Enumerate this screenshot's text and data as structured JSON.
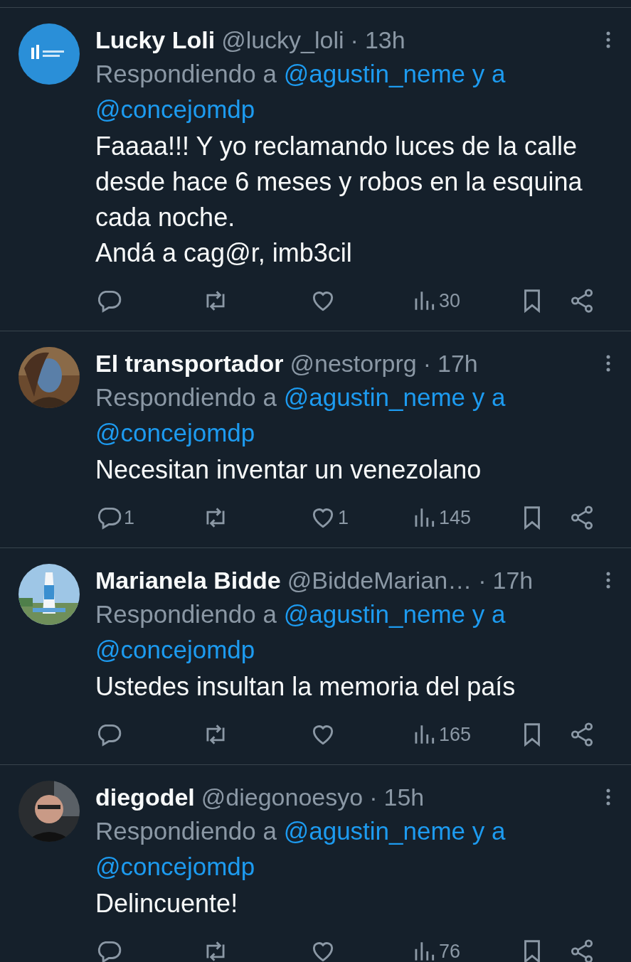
{
  "replies": [
    {
      "name": "Lucky Loli",
      "handle": "@lucky_loli",
      "separator": "·",
      "time": "13h",
      "reply_label": "Respondiendo a",
      "reply_links": [
        "@agustin_neme y a",
        "@concejomdp"
      ],
      "body": [
        "Faaaa!!! Y yo reclamando luces de la calle desde hace 6 meses y robos en la esquina cada noche.",
        "Andá a cag@r, imb3cil"
      ],
      "views": "30"
    },
    {
      "name": "El transportador",
      "handle": "@nestorprg",
      "separator": "·",
      "time": "17h",
      "reply_label": "Respondiendo a",
      "reply_links": [
        "@agustin_neme y a",
        "@concejomdp"
      ],
      "body": [
        "Necesitan inventar un venezolano"
      ],
      "replies_count": "1",
      "likes": "1",
      "views": "145"
    },
    {
      "name": "Marianela Bidde",
      "handle": "@BiddeMarian…",
      "separator": "·",
      "time": "17h",
      "reply_label": "Respondiendo a",
      "reply_links": [
        "@agustin_neme y a",
        "@concejomdp"
      ],
      "body": [
        "Ustedes insultan la memoria del país"
      ],
      "views": "165"
    },
    {
      "name": "diegodel",
      "handle": "@diegonoesyo",
      "separator": "·",
      "time": "15h",
      "reply_label": "Respondiendo a",
      "reply_links": [
        "@agustin_neme y a",
        "@concejomdp"
      ],
      "body": [
        "Delincuente!"
      ],
      "views": "76"
    }
  ]
}
